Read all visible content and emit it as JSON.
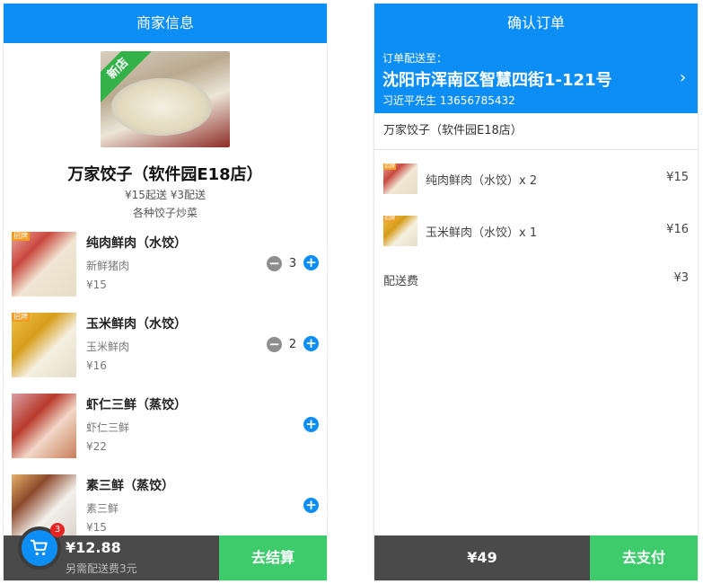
{
  "left_panel": {
    "title": "商家信息",
    "shop": {
      "image_badge": "新店",
      "name": "万家饺子（软件园E18店）",
      "meta": "¥15起送 ¥3配送",
      "description": "各种饺子炒菜"
    },
    "dishes": [
      {
        "badge": "招牌",
        "name": "纯肉鲜肉（水饺）",
        "sub": "新鲜猪肉",
        "price": "¥15",
        "qty": "3"
      },
      {
        "badge": "招牌",
        "name": "玉米鲜肉（水饺）",
        "sub": "玉米鲜肉",
        "price": "¥16",
        "qty": "2"
      },
      {
        "badge": "",
        "name": "虾仁三鲜（蒸饺）",
        "sub": "虾仁三鲜",
        "price": "¥22",
        "qty": ""
      },
      {
        "badge": "",
        "name": "素三鲜（蒸饺）",
        "sub": "素三鲜",
        "price": "¥15",
        "qty": ""
      }
    ],
    "cart": {
      "count": "3",
      "total": "¥12.88",
      "note": "另需配送费3元",
      "checkout_label": "去结算"
    }
  },
  "right_panel": {
    "title": "确认订单",
    "address": {
      "label": "订单配送至：",
      "main": "沈阳市浑南区智慧四街1-121号",
      "contact": "习近平先生 13656785432"
    },
    "shop_name": "万家饺子（软件园E18店）",
    "items": [
      {
        "badge": "招牌",
        "name": "纯肉鲜肉（水饺）x 2",
        "price": "¥15"
      },
      {
        "badge": "招牌",
        "name": "玉米鲜肉（水饺）x 1",
        "price": "¥16"
      }
    ],
    "fee": {
      "label": "配送费",
      "value": "¥3"
    },
    "pay": {
      "total": "¥49",
      "button_label": "去支付"
    }
  },
  "colors": {
    "primary_blue": "#0d8ef5",
    "green": "#3dcb6b",
    "dark_bar": "#4a4a4a",
    "badge_red": "#e62424",
    "badge_orange": "#f39a1f"
  },
  "icons": {
    "cart": "shopping-cart-icon",
    "minus": "minus-circle-icon",
    "plus": "plus-circle-icon",
    "arrow": "chevron-right-icon"
  }
}
